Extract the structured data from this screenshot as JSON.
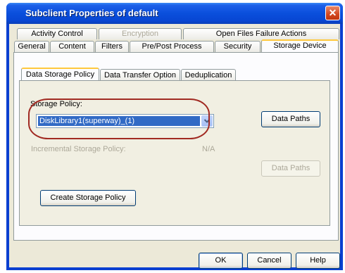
{
  "window": {
    "title": "Subclient Properties of default",
    "close_glyph": "✕"
  },
  "tabs_row_back": [
    {
      "label": "Activity Control",
      "disabled": false
    },
    {
      "label": "Encryption",
      "disabled": true
    },
    {
      "label": "Open Files Failure Actions",
      "disabled": false
    }
  ],
  "tabs_row_front": [
    {
      "label": "General"
    },
    {
      "label": "Content"
    },
    {
      "label": "Filters"
    },
    {
      "label": "Pre/Post Process"
    },
    {
      "label": "Security"
    },
    {
      "label": "Storage Device",
      "active": true
    }
  ],
  "inner_tabs": [
    {
      "label": "Data Storage Policy",
      "active": true
    },
    {
      "label": "Data Transfer Option"
    },
    {
      "label": "Deduplication"
    }
  ],
  "storage_policy": {
    "label": "Storage Policy:",
    "value": "DiskLibrary1(superway)_(1)",
    "data_paths_label": "Data Paths"
  },
  "incremental": {
    "label": "Incremental Storage Policy:",
    "value": "N/A",
    "data_paths_label": "Data Paths"
  },
  "create_policy_label": "Create Storage Policy",
  "footer": {
    "ok": "OK",
    "cancel": "Cancel",
    "help": "Help"
  },
  "colors": {
    "titlebar": "#0a4fdc",
    "dialog_bg": "#ece9d8",
    "selection": "#316ac5",
    "highlight_oval": "#a12a22",
    "active_tab_accent": "#ffc83c"
  }
}
